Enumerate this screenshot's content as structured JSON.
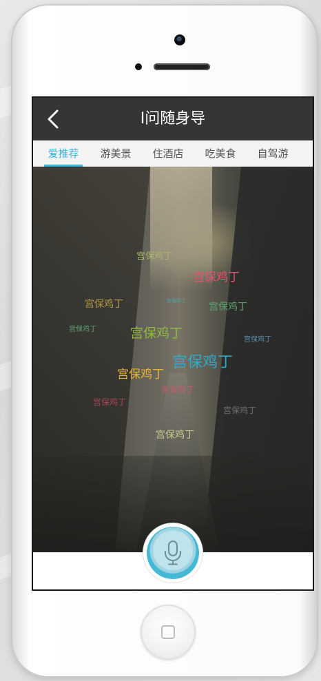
{
  "header": {
    "title": "I问随身导"
  },
  "tabs": [
    {
      "label": "爱推荐",
      "active": true
    },
    {
      "label": "游美景",
      "active": false
    },
    {
      "label": "住酒店",
      "active": false
    },
    {
      "label": "吃美食",
      "active": false
    },
    {
      "label": "自驾游",
      "active": false
    }
  ],
  "cloud_words": [
    {
      "text": "宫保鸡丁",
      "color": "#a9b66a"
    },
    {
      "text": "宫保鸡丁",
      "color": "#e0536e"
    },
    {
      "text": "宫保鸡丁",
      "color": "#b89a4a"
    },
    {
      "text": "宫保鸡丁",
      "color": "#5aa36e"
    },
    {
      "text": "宫保鸡丁",
      "color": "#8fb83e"
    },
    {
      "text": "宫保鸡丁",
      "color": "#5aa36e"
    },
    {
      "text": "宫保鸡丁",
      "color": "#2fa9c9"
    },
    {
      "text": "宫保鸡丁",
      "color": "#e4b234"
    },
    {
      "text": "宫保鸡丁",
      "color": "#5b8fb0"
    },
    {
      "text": "宫保鸡丁",
      "color": "#c35b6a"
    },
    {
      "text": "宫保鸡丁",
      "color": "#a4485a"
    },
    {
      "text": "宫保鸡丁",
      "color": "#c8cc8f"
    },
    {
      "text": "宫保鸡丁",
      "color": "#6b6b6b"
    },
    {
      "text": "宫保鸡丁",
      "color": "#4aa3a6"
    }
  ],
  "icons": {
    "back": "chevron-left-icon",
    "mic": "microphone-icon",
    "home": "home-button-icon"
  },
  "colors": {
    "accent": "#3fb4d8",
    "navbar": "#353535",
    "tabbar": "#f4f4f4"
  }
}
